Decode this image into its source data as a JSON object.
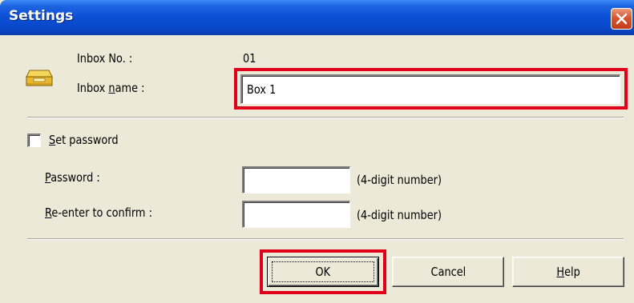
{
  "window": {
    "title": "Settings"
  },
  "inbox": {
    "number_label": "Inbox No. :",
    "number_value": "01",
    "name_label_pre": "Inbox ",
    "name_label_key": "n",
    "name_label_post": "ame :",
    "name_value": "Box 1"
  },
  "password": {
    "checkbox_key": "S",
    "checkbox_rest": "et password",
    "checked": false,
    "password_label_key": "P",
    "password_label_rest": "assword :",
    "confirm_label_key": "R",
    "confirm_label_rest": "e-enter to confirm :",
    "password_value": "",
    "confirm_value": "",
    "hint": "(4-digit number)"
  },
  "buttons": {
    "ok": "OK",
    "cancel": "Cancel",
    "help_key": "H",
    "help_rest": "elp"
  },
  "colors": {
    "highlight": "#e0001a",
    "titlebar": "#0b4fd6",
    "dialog_bg": "#ece9d8"
  },
  "icons": {
    "inbox": "inbox-tray-icon",
    "close": "close-x-icon"
  }
}
